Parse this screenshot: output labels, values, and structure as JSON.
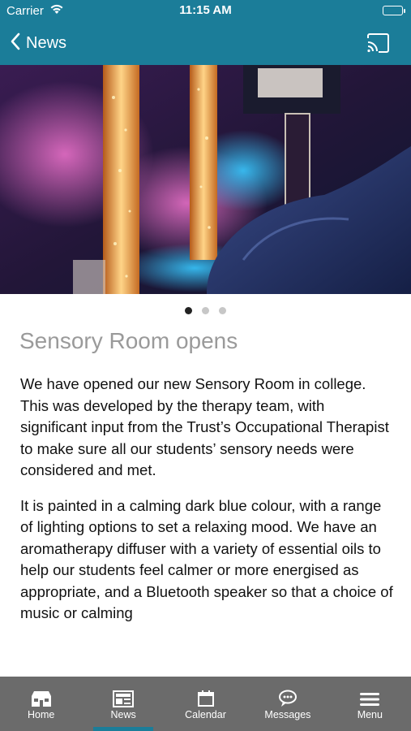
{
  "status_bar": {
    "carrier": "Carrier",
    "time": "11:15 AM"
  },
  "nav": {
    "back_label": "News",
    "cast_icon": "cast-icon"
  },
  "carousel": {
    "slide_count": 3,
    "active_index": 0
  },
  "article": {
    "title": "Sensory Room opens",
    "paragraphs": [
      "We have opened our new Sensory Room in college. This was developed by the therapy team, with significant input from the Trust’s Occupational Therapist to make sure all our students’ sensory needs were considered and met.",
      "It is painted in a calming dark blue colour, with a range of lighting options to set a relaxing mood. We have an aromatherapy diffuser with a variety of essential oils to help our students feel calmer or more energised as appropriate, and a Bluetooth speaker so that a choice of music or calming"
    ]
  },
  "tabbar": {
    "items": [
      {
        "label": "Home",
        "icon": "home-icon"
      },
      {
        "label": "News",
        "icon": "news-icon"
      },
      {
        "label": "Calendar",
        "icon": "calendar-icon"
      },
      {
        "label": "Messages",
        "icon": "messages-icon"
      },
      {
        "label": "Menu",
        "icon": "menu-icon"
      }
    ],
    "active": "News"
  },
  "colors": {
    "brand": "#1b7d99",
    "tabbar": "#6b6b6b",
    "title": "#9a9a9a"
  }
}
